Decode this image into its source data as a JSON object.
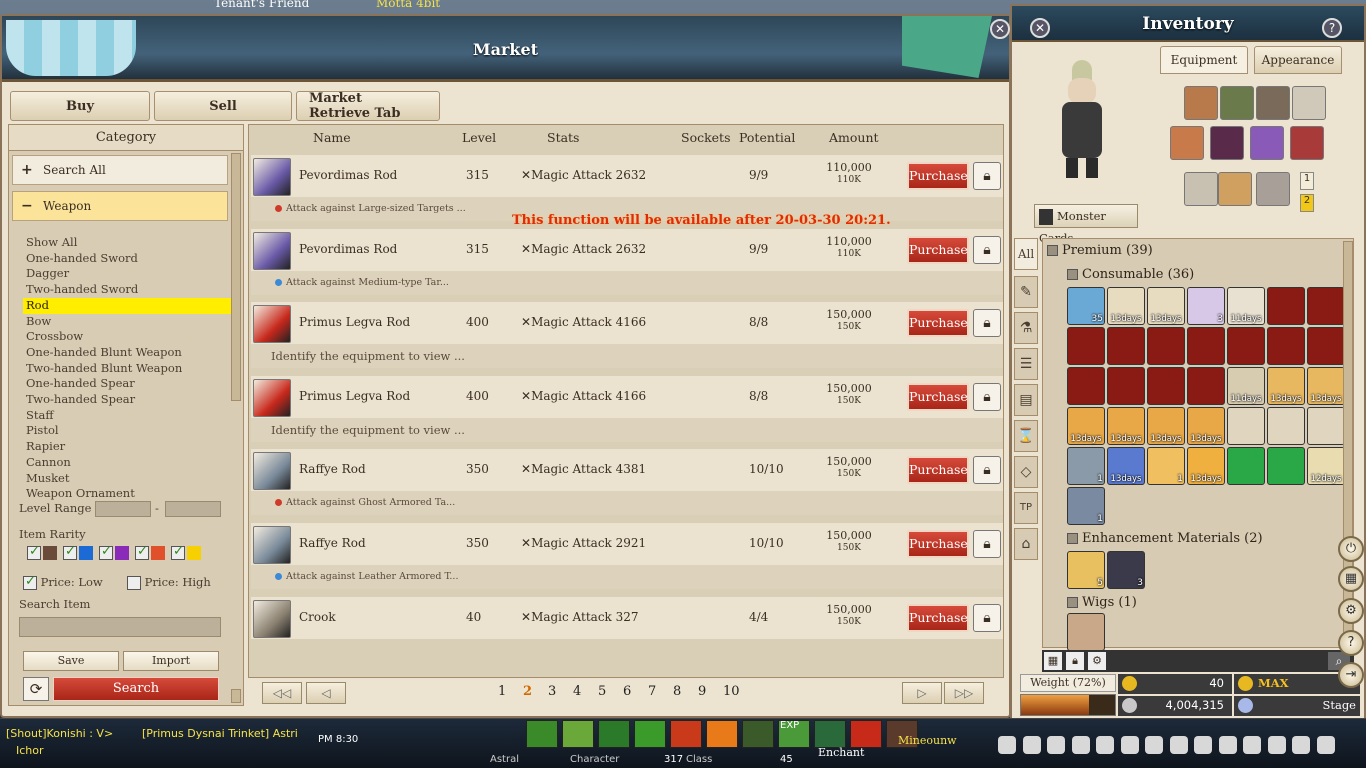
{
  "top_overlay": {
    "left_text": "Tenant's Friend",
    "right_text": "Motta 4bit"
  },
  "market": {
    "title": "Market",
    "tabs": [
      "Buy",
      "Sell",
      "Market Retrieve Tab"
    ],
    "category_header": "Category",
    "search_all": "Search All",
    "weapon": "Weapon",
    "categories": [
      "Show All",
      "One-handed Sword",
      "Dagger",
      "Two-handed Sword",
      "Rod",
      "Bow",
      "Crossbow",
      "One-handed Blunt Weapon",
      "Two-handed Blunt Weapon",
      "One-handed Spear",
      "Two-handed Spear",
      "Staff",
      "Pistol",
      "Rapier",
      "Cannon",
      "Musket",
      "Weapon Ornament"
    ],
    "selected_category": "Rod",
    "level_range_label": "Level Range",
    "level_range_sep": "-",
    "item_rarity_label": "Item Rarity",
    "rarity_colors": [
      "#6a4a38",
      "#1c6ad6",
      "#8a2ab8",
      "#e0502a",
      "#f6d000"
    ],
    "price_low": "Price: Low",
    "price_high": "Price: High",
    "search_item_label": "Search Item",
    "save": "Save",
    "import": "Import",
    "search": "Search",
    "columns": {
      "name": "Name",
      "level": "Level",
      "stats": "Stats",
      "sockets": "Sockets",
      "potential": "Potential",
      "amount": "Amount"
    },
    "notice": "This function will be available after 20-03-30 20:21.",
    "purchase_label": "Purchase",
    "items": [
      {
        "name": "Pevordimas Rod",
        "level": "315",
        "stat": "Magic Attack 2632",
        "potential": "9/9",
        "amount": "110,000",
        "amount_short": "110K",
        "sub": "Attack against Large-sized Targets ...",
        "dot": "#d03a2a",
        "icon": "#6a5aa8"
      },
      {
        "name": "Pevordimas Rod",
        "level": "315",
        "stat": "Magic Attack 2632",
        "potential": "9/9",
        "amount": "110,000",
        "amount_short": "110K",
        "sub": "Attack against Medium-type Tar...",
        "dot": "#3a8ad6",
        "icon": "#6a5aa8"
      },
      {
        "name": "Primus Legva Rod",
        "level": "400",
        "stat": "Magic Attack 4166",
        "potential": "8/8",
        "amount": "150,000",
        "amount_short": "150K",
        "sub": "Identify the equipment to view ...",
        "dot": "",
        "icon": "#c8281c"
      },
      {
        "name": "Primus Legva Rod",
        "level": "400",
        "stat": "Magic Attack 4166",
        "potential": "8/8",
        "amount": "150,000",
        "amount_short": "150K",
        "sub": "Identify the equipment to view ...",
        "dot": "",
        "icon": "#c8281c"
      },
      {
        "name": "Raffye Rod",
        "level": "350",
        "stat": "Magic Attack 4381",
        "potential": "10/10",
        "amount": "150,000",
        "amount_short": "150K",
        "sub": "Attack against Ghost Armored Ta...",
        "dot": "#d03a2a",
        "icon": "#7a8a9a"
      },
      {
        "name": "Raffye Rod",
        "level": "350",
        "stat": "Magic Attack 2921",
        "potential": "10/10",
        "amount": "150,000",
        "amount_short": "150K",
        "sub": "Attack against Leather Armored T...",
        "dot": "#3a8ad6",
        "icon": "#7a8a9a"
      },
      {
        "name": "Crook",
        "level": "40",
        "stat": "Magic Attack 327",
        "potential": "4/4",
        "amount": "150,000",
        "amount_short": "150K",
        "sub": "",
        "dot": "",
        "icon": "#8a8070"
      }
    ],
    "pages": [
      "1",
      "2",
      "3",
      "4",
      "5",
      "6",
      "7",
      "8",
      "9",
      "10"
    ],
    "current_page": "2"
  },
  "inventory": {
    "title": "Inventory",
    "tab_equipment": "Equipment",
    "tab_appearance": "Appearance",
    "monster_cards": "Monster Cards",
    "badge1": "1",
    "badge2": "2",
    "all": "All",
    "premium": "Premium (39)",
    "consumable": "Consumable (36)",
    "enhancement": "Enhancement Materials (2)",
    "wigs": "Wigs (1)",
    "weight": "Weight (72%)",
    "weight_fraction": 0.72,
    "tp": "40",
    "silver": "4,004,315",
    "max": "MAX",
    "stage": "Stage"
  },
  "consumable_items": [
    {
      "c": "#6aa8d6",
      "t": "35"
    },
    {
      "c": "#e8dcc0",
      "t": "13days"
    },
    {
      "c": "#e8dcc0",
      "t": "13days"
    },
    {
      "c": "#d8c8e8",
      "t": "3"
    },
    {
      "c": "#e8e0d0",
      "t": "11days"
    },
    {
      "c": "#8a1a14",
      "t": ""
    },
    {
      "c": "#8a1a14",
      "t": ""
    },
    {
      "c": "#8a1a14",
      "t": ""
    },
    {
      "c": "#8a1a14",
      "t": ""
    },
    {
      "c": "#8a1a14",
      "t": ""
    },
    {
      "c": "#8a1a14",
      "t": ""
    },
    {
      "c": "#8a1a14",
      "t": ""
    },
    {
      "c": "#8a1a14",
      "t": ""
    },
    {
      "c": "#8a1a14",
      "t": ""
    },
    {
      "c": "#8a1a14",
      "t": ""
    },
    {
      "c": "#8a1a14",
      "t": ""
    },
    {
      "c": "#8a1a14",
      "t": ""
    },
    {
      "c": "#8a1a14",
      "t": ""
    },
    {
      "c": "#d8ccb0",
      "t": "11days"
    },
    {
      "c": "#e8b860",
      "t": "13days"
    },
    {
      "c": "#e8b860",
      "t": "13days"
    },
    {
      "c": "#e8a848",
      "t": "13days"
    },
    {
      "c": "#e8a848",
      "t": "13days"
    },
    {
      "c": "#e8a848",
      "t": "13days"
    },
    {
      "c": "#e8a848",
      "t": "13days"
    },
    {
      "c": "#e0d6c0",
      "t": ""
    },
    {
      "c": "#e0d6c0",
      "t": ""
    },
    {
      "c": "#e0d6c0",
      "t": ""
    },
    {
      "c": "#8a9aa8",
      "t": "1"
    },
    {
      "c": "#5a7ad0",
      "t": "13days"
    },
    {
      "c": "#f0c060",
      "t": "1"
    },
    {
      "c": "#f0b040",
      "t": "13days"
    },
    {
      "c": "#2aa848",
      "t": ""
    },
    {
      "c": "#2aa848",
      "t": ""
    },
    {
      "c": "#e8dcb0",
      "t": "12days"
    },
    {
      "c": "#7a8aa0",
      "t": "1"
    }
  ],
  "bottom": {
    "chat1": "[Shout]Konishi : V>",
    "chat1b": "[Primus Dysnai Trinket] Astri",
    "chat2": "Ichor",
    "time": "PM 8:30",
    "character": "Character",
    "char_val": "317",
    "class": "Class",
    "class_val": "45",
    "enchant": "Enchant",
    "mineounw": "Mineounw",
    "exp": "EXP",
    "astral": "Astral"
  }
}
